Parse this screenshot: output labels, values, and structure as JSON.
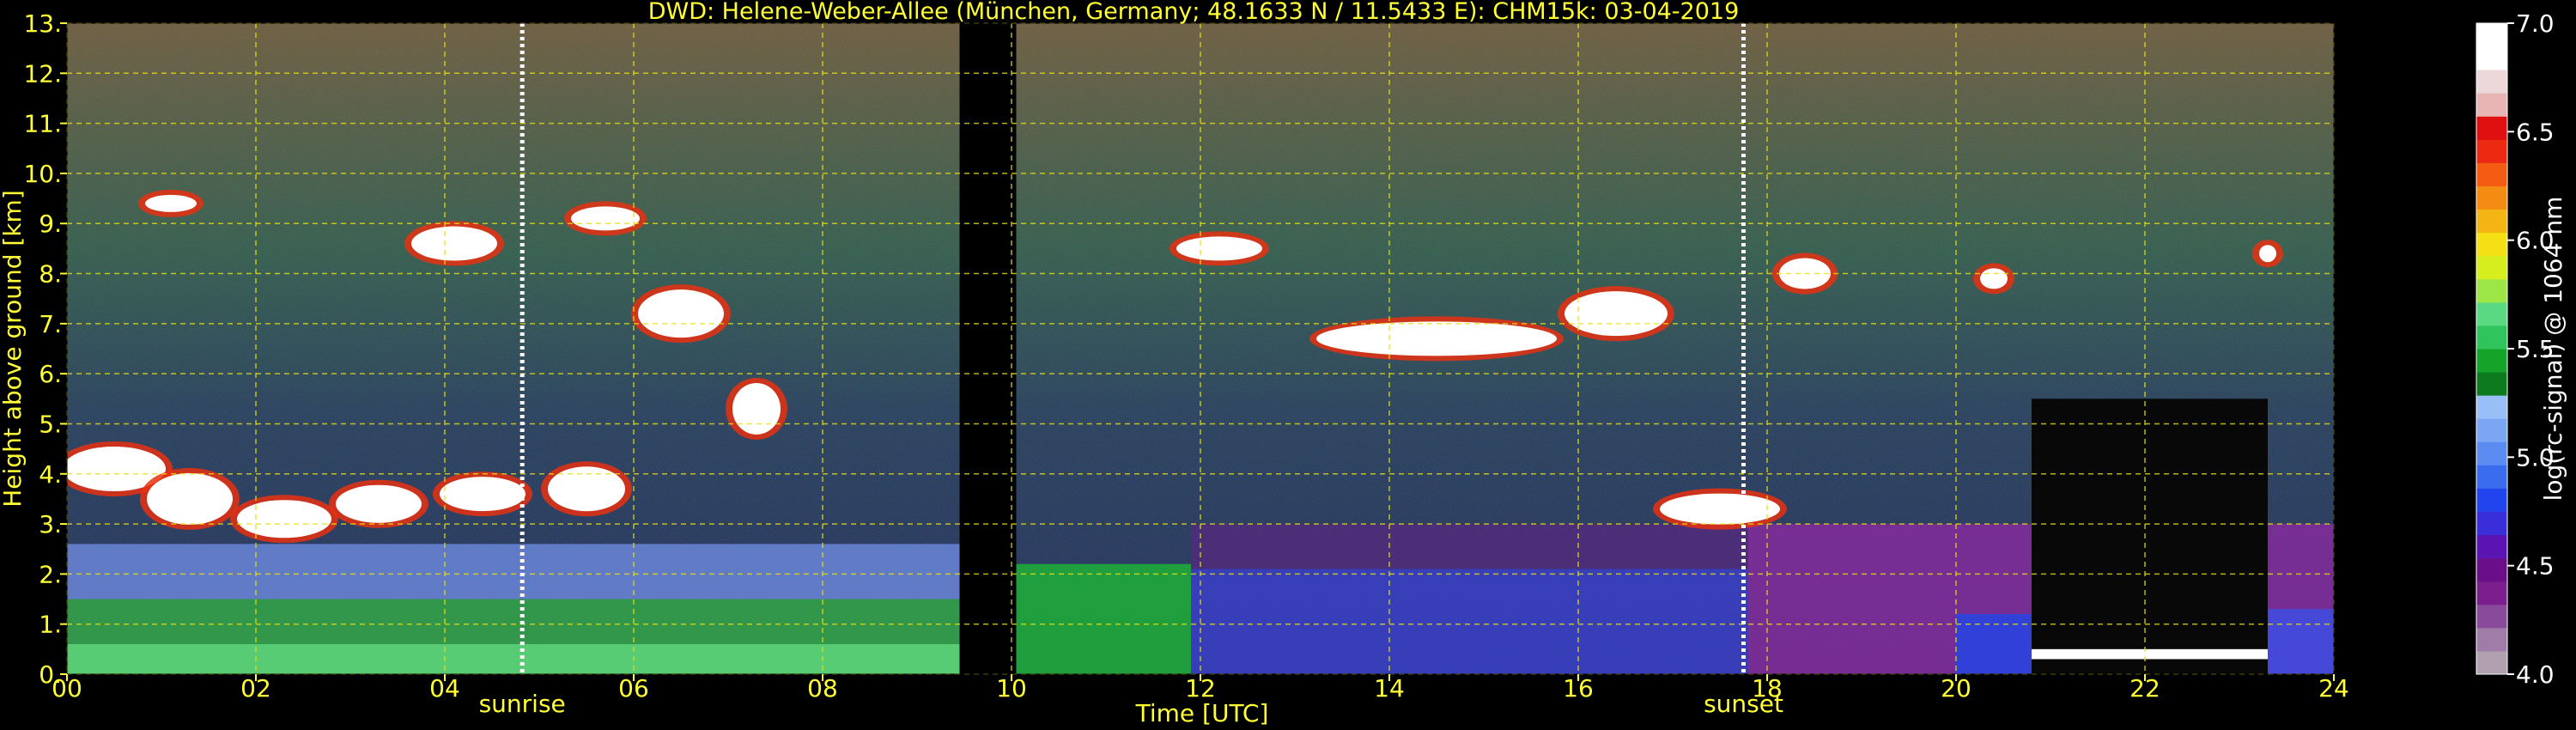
{
  "chart_data": {
    "type": "heatmap",
    "title": "DWD: Helene-Weber-Allee (München, Germany; 48.1633 N / 11.5433 E):    CHM15k: 03-04-2019",
    "xlabel": "Time [UTC]",
    "ylabel": "Height above ground [km]",
    "xlim": [
      0,
      24
    ],
    "ylim": [
      0,
      13
    ],
    "x_ticks": [
      {
        "value": 0,
        "label": "00"
      },
      {
        "value": 2,
        "label": "02"
      },
      {
        "value": 4,
        "label": "04"
      },
      {
        "value": 6,
        "label": "06"
      },
      {
        "value": 8,
        "label": "08"
      },
      {
        "value": 10,
        "label": "10"
      },
      {
        "value": 12,
        "label": "12"
      },
      {
        "value": 14,
        "label": "14"
      },
      {
        "value": 16,
        "label": "16"
      },
      {
        "value": 18,
        "label": "18"
      },
      {
        "value": 20,
        "label": "20"
      },
      {
        "value": 22,
        "label": "22"
      },
      {
        "value": 24,
        "label": "24"
      }
    ],
    "y_ticks": [
      {
        "value": 0,
        "label": "0."
      },
      {
        "value": 1,
        "label": "1."
      },
      {
        "value": 2,
        "label": "2."
      },
      {
        "value": 3,
        "label": "3."
      },
      {
        "value": 4,
        "label": "4."
      },
      {
        "value": 5,
        "label": "5."
      },
      {
        "value": 6,
        "label": "6."
      },
      {
        "value": 7,
        "label": "7."
      },
      {
        "value": 8,
        "label": "8."
      },
      {
        "value": 9,
        "label": "9."
      },
      {
        "value": 10,
        "label": "10."
      },
      {
        "value": 11,
        "label": "11."
      },
      {
        "value": 12,
        "label": "12."
      },
      {
        "value": 13,
        "label": "13."
      }
    ],
    "grid": true,
    "markers": [
      {
        "label": "sunrise",
        "time": 4.82
      },
      {
        "label": "sunset",
        "time": 17.75
      }
    ],
    "data_gap": {
      "start": 9.45,
      "end": 10.05
    },
    "colorbar": {
      "label": "log(rc-signal) @ 1064 nm",
      "range": [
        4.0,
        7.0
      ],
      "ticks": [
        {
          "value": 4.0,
          "label": "4.0"
        },
        {
          "value": 4.5,
          "label": "4.5"
        },
        {
          "value": 5.0,
          "label": "5.0"
        },
        {
          "value": 5.5,
          "label": "5.5"
        },
        {
          "value": 6.0,
          "label": "6.0"
        },
        {
          "value": 6.5,
          "label": "6.5"
        },
        {
          "value": 7.0,
          "label": "7.0"
        }
      ],
      "colors": [
        "#b0a0b0",
        "#a07ca8",
        "#8a4a9a",
        "#7a1e8e",
        "#6a0e8a",
        "#5a14b4",
        "#3a2ed8",
        "#2244ee",
        "#3a6cf0",
        "#5c8cf2",
        "#7aa6f4",
        "#9abef6",
        "#0e7a1e",
        "#16a32a",
        "#2fc45c",
        "#5ad882",
        "#9ee646",
        "#d6ee1e",
        "#f4e014",
        "#f4b414",
        "#f48c14",
        "#f45c14",
        "#ec2a12",
        "#e01010",
        "#e8b4b4",
        "#ecd8d8",
        "#ffffff",
        "#ffffff"
      ]
    }
  }
}
